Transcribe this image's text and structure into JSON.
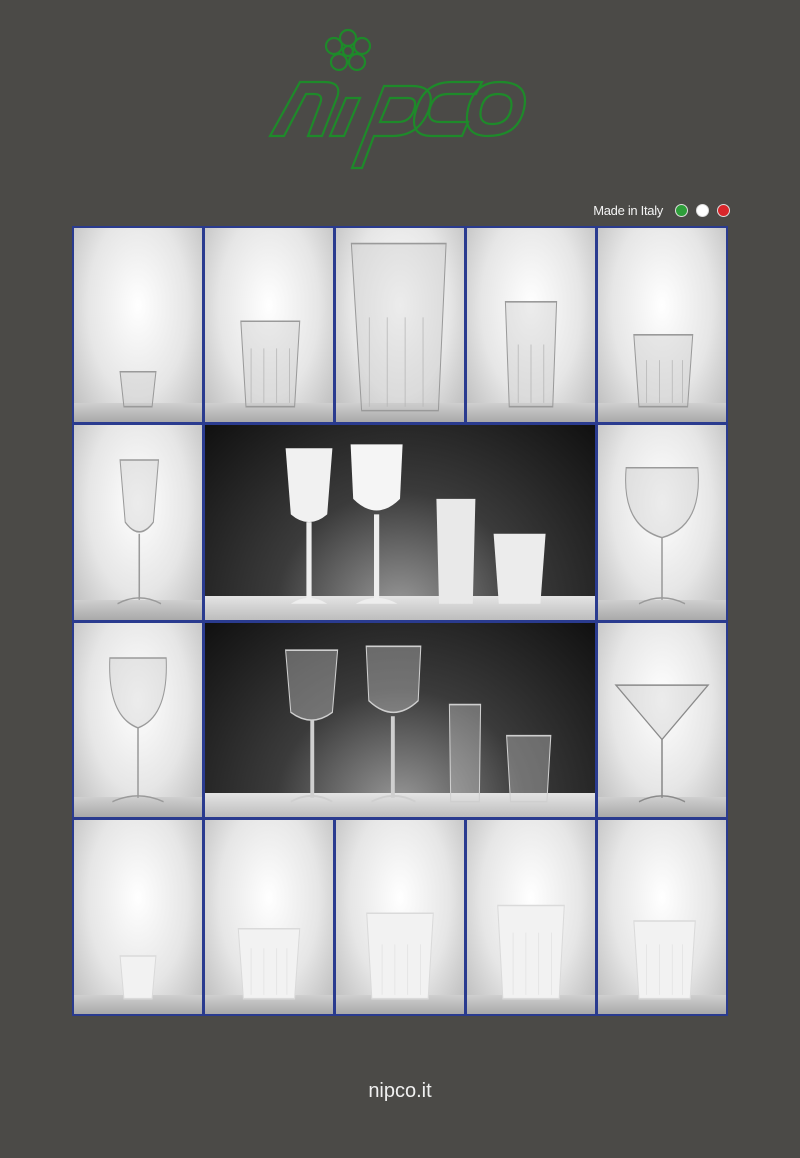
{
  "brand": {
    "name": "nipco",
    "logo_color": "#1e8a2a"
  },
  "badge": {
    "text": "Made in Italy",
    "flag_colors": [
      "#2e9e3a",
      "#ffffff",
      "#d9262b"
    ]
  },
  "catalog": {
    "rows": [
      [
        "shot-tumbler-clear",
        "tumbler-clear",
        "tall-tumbler-clear",
        "highball-tumbler-clear",
        "rocks-tumbler-clear"
      ],
      [
        "champagne-flute-clear",
        "white-glassware-set",
        "balloon-wine-glass-clear"
      ],
      [
        "wine-glass-clear",
        "clear-glassware-set",
        "martini-glass-clear"
      ],
      [
        "shot-tumbler-frosted",
        "tumbler-frosted",
        "tall-tumbler-frosted",
        "highball-tumbler-frosted",
        "rocks-tumbler-frosted"
      ]
    ]
  },
  "footer": {
    "url": "nipco.it"
  }
}
